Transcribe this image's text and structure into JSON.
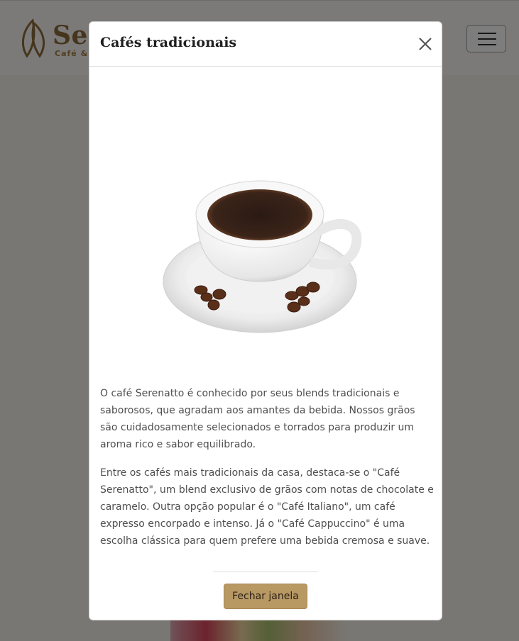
{
  "brand": {
    "name": "Sere",
    "tagline": "Café & R"
  },
  "menu": {
    "icon": "hamburger-icon"
  },
  "modal": {
    "title": "Cafés tradicionais",
    "close_icon": "close-icon",
    "image_subject": "coffee-cup-icon",
    "paragraphs": [
      "O café Serenatto é conhecido por seus blends tradicionais e saborosos, que agradam aos amantes da bebida. Nossos grãos são cuidadosamente selecionados e torrados para produzir um aroma rico e sabor equilibrado.",
      "Entre os cafés mais tradicionais da casa, destaca-se o \"Café Serenatto\", um blend exclusivo de grãos com notas de chocolate e caramelo. Outra opção popular é o \"Café Italiano\", um café expresso encorpado e intenso. Já o \"Café Cappuccino\" é uma escolha clássica para quem prefere uma bebida cremosa e suave."
    ],
    "footer_button": "Fechar janela"
  },
  "colors": {
    "accent": "#b89863",
    "brand": "#8a6a3a",
    "backdrop": "rgba(0,0,0,0.5)"
  }
}
